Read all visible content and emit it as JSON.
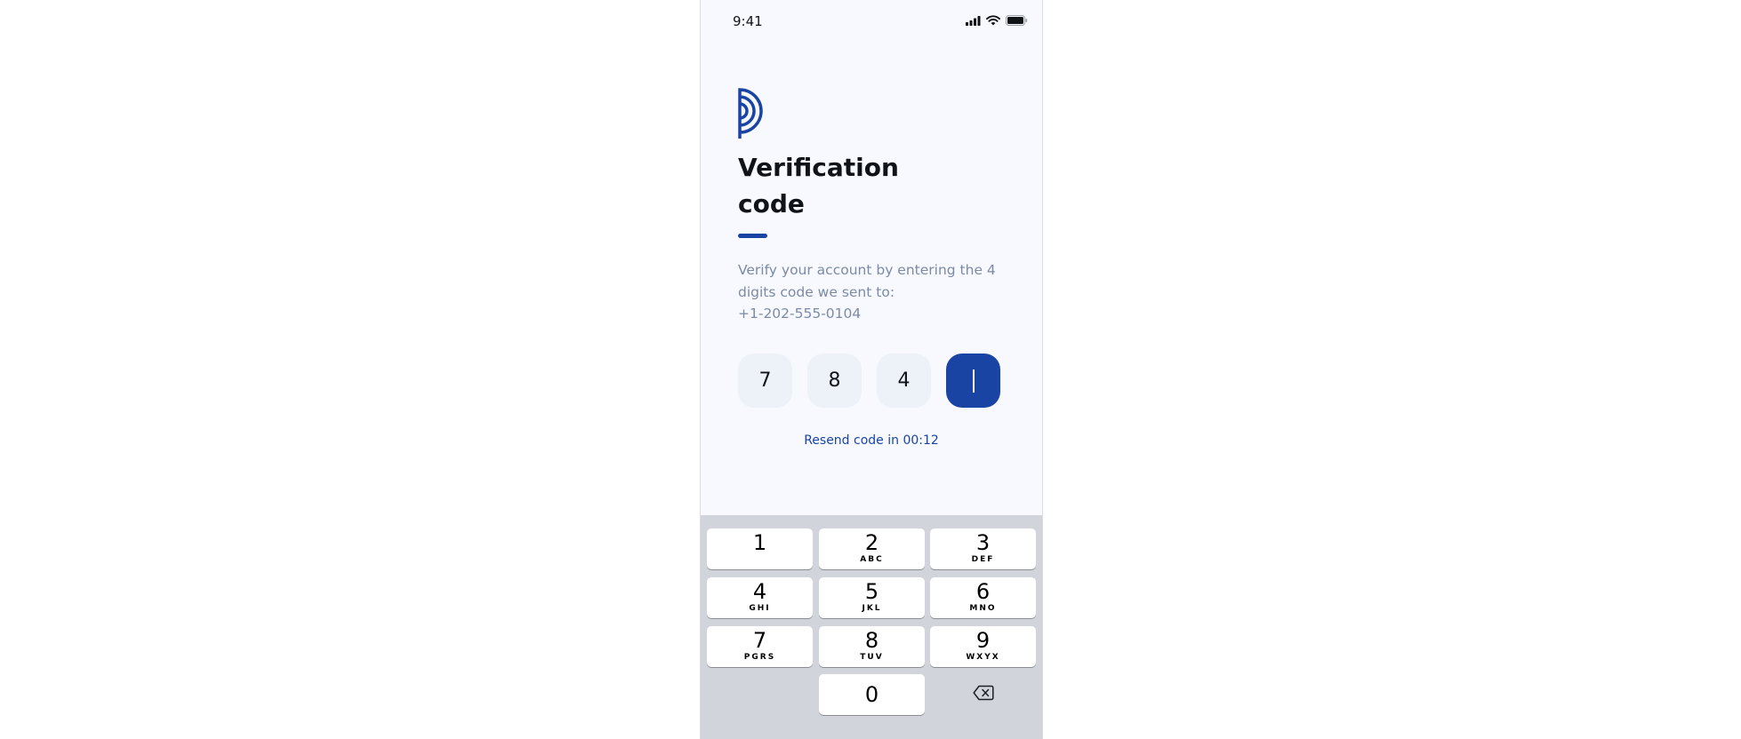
{
  "status_bar": {
    "time": "9:41"
  },
  "title_lines": [
    "Verification",
    "code"
  ],
  "description": {
    "line1": "Verify your account by entering the 4",
    "line2": "digits code we sent to:",
    "phone": "+1-202-555-0104"
  },
  "code_digits": [
    "7",
    "8",
    "4",
    ""
  ],
  "resend_text": "Resend code in 00:12",
  "keypad": [
    {
      "num": "1",
      "letters": ""
    },
    {
      "num": "2",
      "letters": "ABC"
    },
    {
      "num": "3",
      "letters": "DEF"
    },
    {
      "num": "4",
      "letters": "GHI"
    },
    {
      "num": "5",
      "letters": "JKL"
    },
    {
      "num": "6",
      "letters": "MNO"
    },
    {
      "num": "7",
      "letters": "PGRS"
    },
    {
      "num": "8",
      "letters": "TUV"
    },
    {
      "num": "9",
      "letters": "WXYX"
    },
    {
      "num": "0",
      "letters": ""
    }
  ],
  "colors": {
    "brand": "#1a44a4",
    "background": "#f7f9fe",
    "muted_text": "#7c8aa6",
    "code_box": "#edf1f8"
  },
  "icons": {
    "logo": "brand-logo-icon",
    "backspace": "backspace-icon",
    "signal": "signal-icon",
    "wifi": "wifi-icon",
    "battery": "battery-icon"
  }
}
